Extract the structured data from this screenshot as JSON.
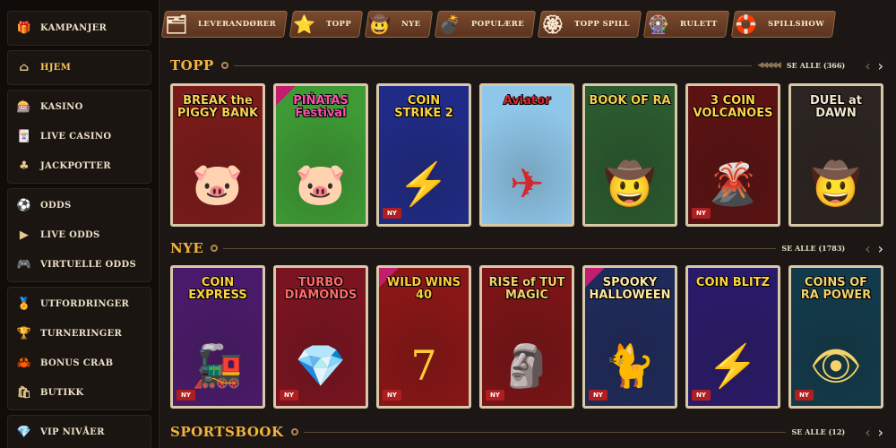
{
  "sidebar": {
    "groups": [
      [
        {
          "label": "KAMPANJER",
          "icon": "gift-icon",
          "glyph": "🎁",
          "active": false
        }
      ],
      [
        {
          "label": "HJEM",
          "icon": "home-icon",
          "glyph": "⌂",
          "active": true
        }
      ],
      [
        {
          "label": "KASINO",
          "icon": "casino-icon",
          "glyph": "🎰",
          "active": false
        },
        {
          "label": "LIVE CASINO",
          "icon": "cards-icon",
          "glyph": "🃏",
          "active": false
        },
        {
          "label": "JACKPOTTER",
          "icon": "clover-icon",
          "glyph": "♣",
          "active": false
        }
      ],
      [
        {
          "label": "ODDS",
          "icon": "ball-icon",
          "glyph": "⚽",
          "active": false
        },
        {
          "label": "LIVE ODDS",
          "icon": "play-icon",
          "glyph": "▶",
          "active": false
        },
        {
          "label": "VIRTUELLE ODDS",
          "icon": "gamepad-icon",
          "glyph": "🎮",
          "active": false
        }
      ],
      [
        {
          "label": "UTFORDRINGER",
          "icon": "medal-icon",
          "glyph": "🏅",
          "active": false
        },
        {
          "label": "TURNERINGER",
          "icon": "trophy-icon",
          "glyph": "🏆",
          "active": false
        },
        {
          "label": "BONUS CRAB",
          "icon": "crab-icon",
          "glyph": "🦀",
          "active": false
        },
        {
          "label": "BUTIKK",
          "icon": "shop-icon",
          "glyph": "🛍",
          "active": false
        }
      ],
      [
        {
          "label": "VIP NIVÅER",
          "icon": "diamond-icon",
          "glyph": "💎",
          "active": false
        }
      ]
    ]
  },
  "categories": [
    {
      "label": "LEVERANDØRER",
      "icon": "provider-icon",
      "glyph": "🗂"
    },
    {
      "label": "TOPP",
      "icon": "star-badge-icon",
      "glyph": "⭐"
    },
    {
      "label": "NYE",
      "icon": "cowboy-hat-icon",
      "glyph": "🤠"
    },
    {
      "label": "POPULÆRE",
      "icon": "bomb-icon",
      "glyph": "💣"
    },
    {
      "label": "TOPP SPILL",
      "icon": "sun-badge-icon",
      "glyph": "🏵"
    },
    {
      "label": "RULETT",
      "icon": "roulette-icon",
      "glyph": "🎡"
    },
    {
      "label": "SPILLSHOW",
      "icon": "lifebuoy-icon",
      "glyph": "🛟"
    }
  ],
  "sections": {
    "topp": {
      "title": "TOPP",
      "see_all": "SE ALLE (366)"
    },
    "nye": {
      "title": "NYE",
      "see_all": "SE ALLE (1783)"
    },
    "sportsbook": {
      "title": "SPORTSBOOK",
      "see_all": "SE ALLE (12)"
    }
  },
  "topp_games": [
    {
      "name": "BREAK the PIGGY BANK",
      "badge": "",
      "bg": "#7a1a1a",
      "color": "#f7d154",
      "art": "🐷",
      "ribbon": false
    },
    {
      "name": "PIÑATAS Festival",
      "badge": "",
      "bg": "#3d9a34",
      "color": "#ff4fb0",
      "art": "🐷",
      "ribbon": true
    },
    {
      "name": "COIN STRIKE 2",
      "badge": "NY",
      "bg": "#1f2b86",
      "color": "#ffd43a",
      "art": "⚡",
      "ribbon": false
    },
    {
      "name": "Aviator",
      "badge": "",
      "bg": "#8fc7ea",
      "color": "#d8262d",
      "art": "✈",
      "ribbon": false
    },
    {
      "name": "BOOK OF RA",
      "badge": "",
      "bg": "#2a5a2e",
      "color": "#f4cf4d",
      "art": "🤠",
      "ribbon": false
    },
    {
      "name": "3 COIN VOLCANOES",
      "badge": "NY",
      "bg": "#5a1212",
      "color": "#ffd447",
      "art": "🌋",
      "ribbon": false
    },
    {
      "name": "DUEL at DAWN",
      "badge": "",
      "bg": "#2b2420",
      "color": "#f3e6cf",
      "art": "🤠",
      "ribbon": false
    }
  ],
  "nye_games": [
    {
      "name": "COIN EXPRESS",
      "badge": "NY",
      "bg": "#4a1a6a",
      "color": "#ffd43a",
      "art": "🚂",
      "ribbon": false
    },
    {
      "name": "TURBO DIAMONDS",
      "badge": "NY",
      "bg": "#7a1420",
      "color": "#ff6a6a",
      "art": "💎",
      "ribbon": false
    },
    {
      "name": "WILD WINS 40",
      "badge": "NY",
      "bg": "#8a1616",
      "color": "#ffcc3a",
      "art": "7",
      "ribbon": true
    },
    {
      "name": "RISE of TUT MAGIC",
      "badge": "NY",
      "bg": "#7a1416",
      "color": "#f5d06a",
      "art": "🗿",
      "ribbon": false
    },
    {
      "name": "SPOOKY HALLOWEEN",
      "badge": "NY",
      "bg": "#1e2a5a",
      "color": "#ffe7a0",
      "art": "🐈",
      "ribbon": true
    },
    {
      "name": "COIN BLITZ",
      "badge": "NY",
      "bg": "#2a1a6a",
      "color": "#ffd43a",
      "art": "⚡",
      "ribbon": false
    },
    {
      "name": "COINS OF RA POWER",
      "badge": "NY",
      "bg": "#123a4a",
      "color": "#f3d36a",
      "art": "👁",
      "ribbon": false
    }
  ]
}
